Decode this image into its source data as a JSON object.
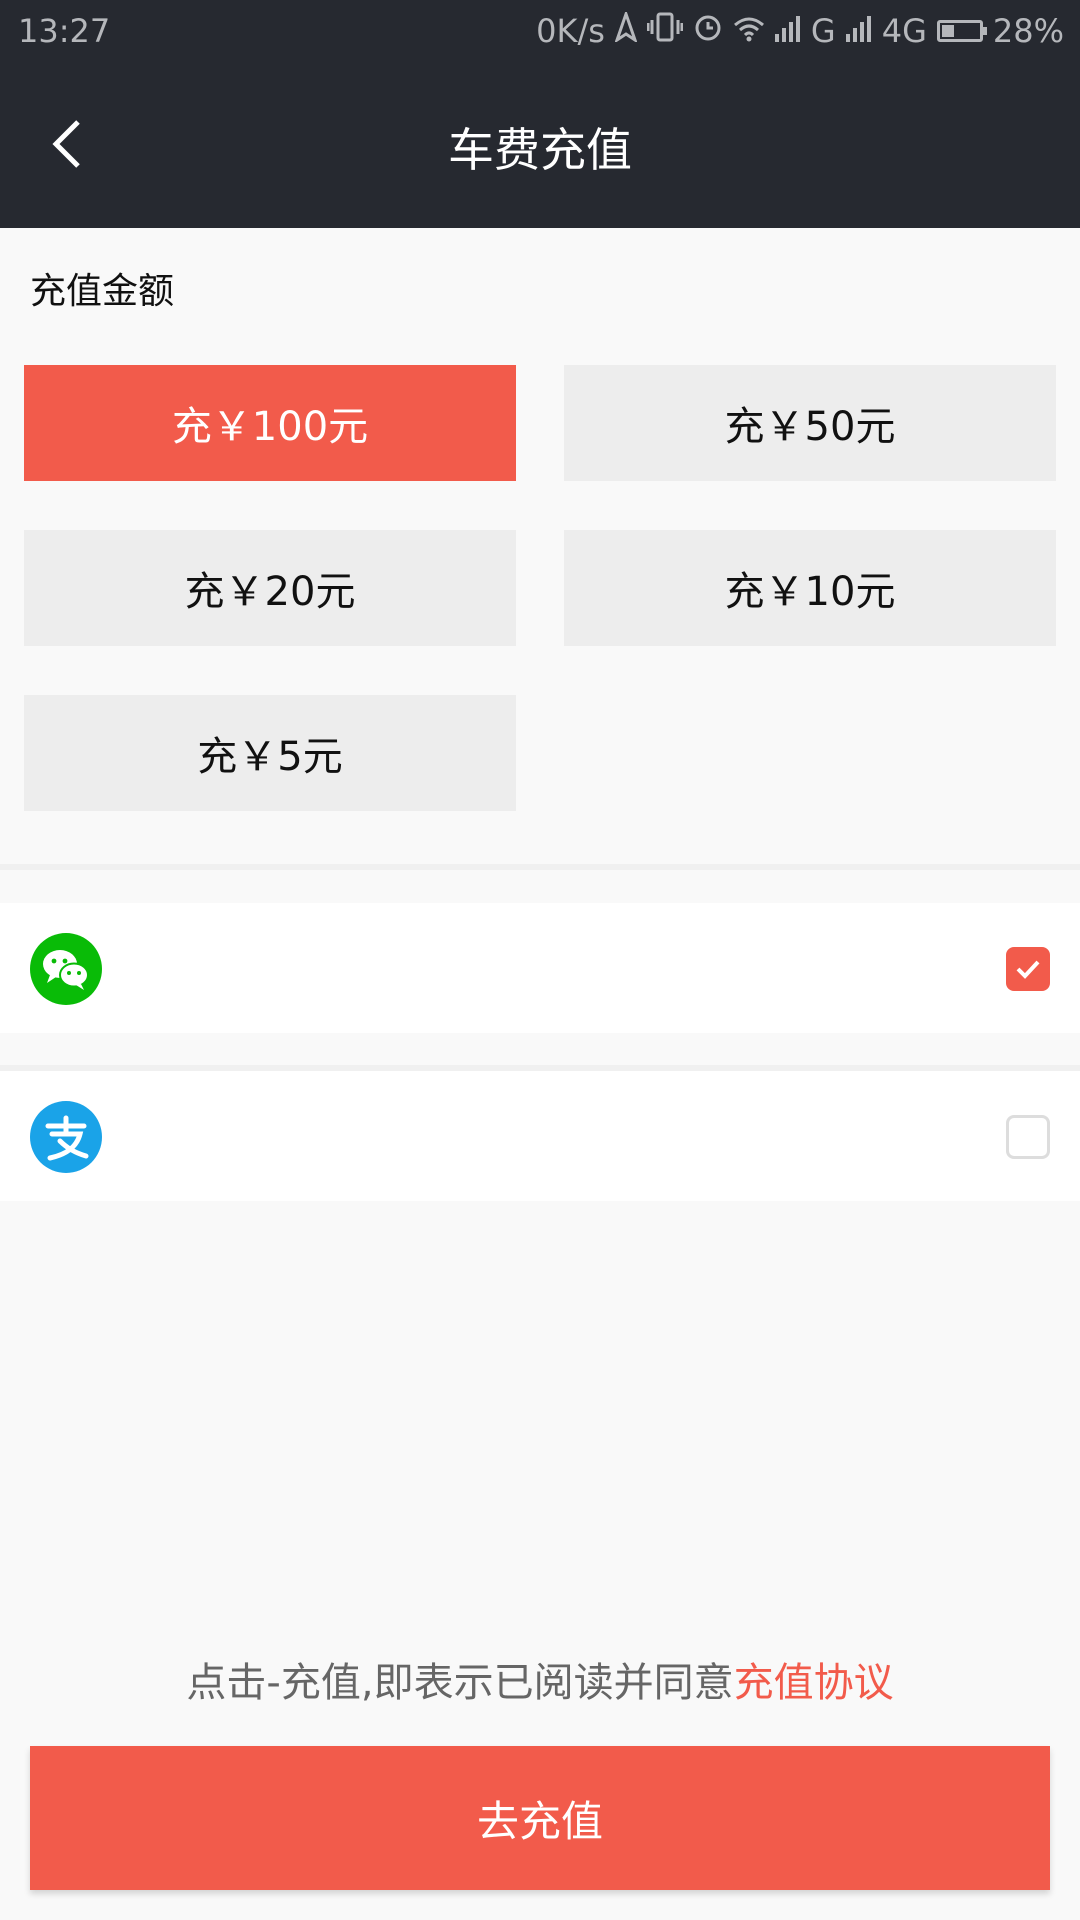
{
  "status_bar": {
    "time": "13:27",
    "net_speed": "0K/s",
    "network_g": "G",
    "network_4g": "4G",
    "battery": "28%"
  },
  "nav": {
    "title": "车费充值"
  },
  "amount_section": {
    "label": "充值金额",
    "options": [
      {
        "label": "充￥100元",
        "selected": true
      },
      {
        "label": "充￥50元",
        "selected": false
      },
      {
        "label": "充￥20元",
        "selected": false
      },
      {
        "label": "充￥10元",
        "selected": false
      },
      {
        "label": "充￥5元",
        "selected": false
      }
    ]
  },
  "payment_methods": [
    {
      "icon": "wechat-pay-icon",
      "checked": true,
      "color": "#09bb07"
    },
    {
      "icon": "alipay-icon",
      "checked": false,
      "color": "#1aa3e8"
    }
  ],
  "agreement": {
    "text": "点击-充值,即表示已阅读并同意",
    "link": "充值协议"
  },
  "submit_label": "去充值",
  "colors": {
    "accent": "#f25b4b",
    "header_bg": "#262930"
  }
}
